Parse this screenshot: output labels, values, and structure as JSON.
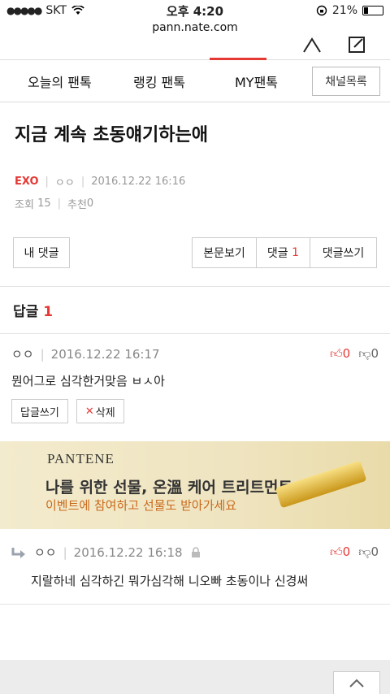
{
  "status_bar": {
    "carrier": "SKT",
    "time": "오후 4:20",
    "battery": "21%",
    "battery_level": 0.21
  },
  "browser": {
    "url": "pann.nate.com"
  },
  "tabs": [
    {
      "label": "오늘의 팬톡"
    },
    {
      "label": "랭킹 팬톡"
    },
    {
      "label": "MY팬톡"
    }
  ],
  "channel_button": "채널목록",
  "post": {
    "title": "지금 계속 초동얘기하는애",
    "category": "EXO",
    "author": "ㅇㅇ",
    "datetime": "2016.12.22 16:16",
    "views_label": "조회",
    "views": "15",
    "recommend_label": "추천",
    "recommend": "0"
  },
  "buttons": {
    "my_comments": "내 댓글",
    "view_post": "본문보기",
    "comments": "댓글",
    "comments_count": "1",
    "write_comment": "댓글쓰기"
  },
  "replies_header": {
    "label": "답글",
    "count": "1"
  },
  "comment": {
    "author": "ㅇㅇ",
    "datetime": "2016.12.22 16:17",
    "up": "0",
    "down": "0",
    "text": "뭔어그로 심각한거맞음 ㅂㅅ아",
    "reply_button": "답글쓰기",
    "delete_button": "삭제"
  },
  "ad": {
    "brand": "PANTENE",
    "headline": "나를 위한 선물, 온溫 케어 트리트먼트",
    "sub": "이벤트에 참여하고 선물도 받아가세요"
  },
  "reply": {
    "author": "ㅇㅇ",
    "datetime": "2016.12.22 16:18",
    "up": "0",
    "down": "0",
    "text": "지랄하네 심각하긴 뭐가심각해 니오빠 초동이나 신경써"
  }
}
